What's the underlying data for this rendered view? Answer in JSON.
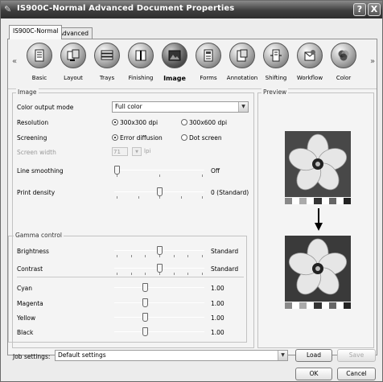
{
  "window": {
    "title": "IS900C-Normal Advanced Document Properties",
    "help_label": "?",
    "close_label": "X"
  },
  "tabs": [
    {
      "label": "IS900C-Normal"
    },
    {
      "label": "Advanced"
    }
  ],
  "iconbar": {
    "scroll_left": "«",
    "scroll_right": "»",
    "items": [
      {
        "label": "Basic",
        "icon": "basic-icon"
      },
      {
        "label": "Layout",
        "icon": "layout-icon"
      },
      {
        "label": "Trays",
        "icon": "trays-icon"
      },
      {
        "label": "Finishing",
        "icon": "finishing-icon"
      },
      {
        "label": "Image",
        "icon": "image-icon",
        "selected": true
      },
      {
        "label": "Forms",
        "icon": "forms-icon"
      },
      {
        "label": "Annotation",
        "icon": "annotation-icon"
      },
      {
        "label": "Shifting",
        "icon": "shifting-icon"
      },
      {
        "label": "Workflow",
        "icon": "workflow-icon"
      },
      {
        "label": "Color",
        "icon": "color-icon"
      }
    ]
  },
  "image": {
    "group_label": "Image",
    "color_output": {
      "label": "Color output mode",
      "value": "Full color"
    },
    "resolution": {
      "label": "Resolution",
      "options": [
        "300x300 dpi",
        "300x600 dpi"
      ],
      "selected": 0
    },
    "screening": {
      "label": "Screening",
      "options": [
        "Error diffusion",
        "Dot screen"
      ],
      "selected": 0
    },
    "screen_width": {
      "label": "Screen width",
      "value": "71",
      "unit": "lpi"
    },
    "line_smoothing": {
      "label": "Line smoothing",
      "value": "Off",
      "level": 0
    },
    "print_density": {
      "label": "Print density",
      "value": "0 (Standard)",
      "level": 0.5
    }
  },
  "gamma": {
    "group_label": "Gamma control",
    "brightness": {
      "label": "Brightness",
      "value": "Standard",
      "level": 0.5
    },
    "contrast": {
      "label": "Contrast",
      "value": "Standard",
      "level": 0.5
    },
    "channels": [
      {
        "label": "Cyan",
        "value": "1.00",
        "level": 0.33
      },
      {
        "label": "Magenta",
        "value": "1.00",
        "level": 0.33
      },
      {
        "label": "Yellow",
        "value": "1.00",
        "level": 0.33
      },
      {
        "label": "Black",
        "value": "1.00",
        "level": 0.33
      }
    ]
  },
  "preview": {
    "group_label": "Preview"
  },
  "footer": {
    "job_settings_label": "Job settings:",
    "job_settings_value": "Default settings",
    "load_label": "Load",
    "save_label": "Save",
    "ok_label": "OK",
    "cancel_label": "Cancel"
  },
  "colors": {
    "titlebar": "#3e3e3e",
    "panel": "#f4f4f4",
    "accent": "#000000"
  }
}
